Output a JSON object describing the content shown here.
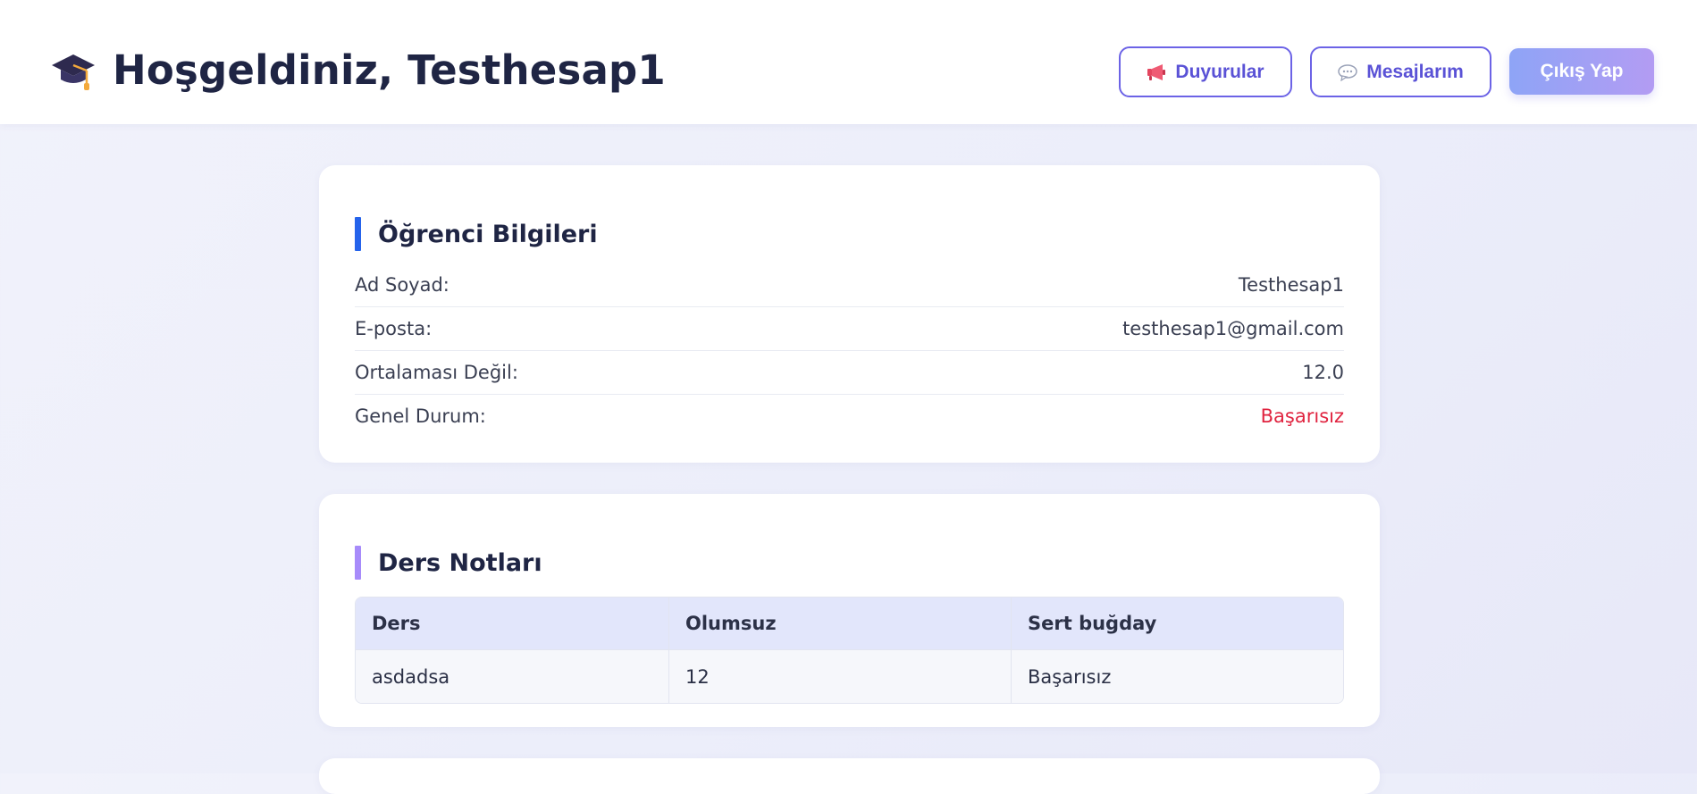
{
  "header": {
    "welcome": "Hoşgeldiniz, Testhesap1",
    "announcements_label": "Duyurular",
    "messages_label": "Mesajlarım",
    "logout_label": "Çıkış Yap",
    "icons": {
      "logo": "graduation-cap-icon",
      "announcements": "megaphone-icon",
      "messages": "speech-bubble-icon"
    }
  },
  "student_info": {
    "title": "Öğrenci Bilgileri",
    "accent": "#2563eb",
    "rows": [
      {
        "label": "Ad Soyad:",
        "value": "Testhesap1"
      },
      {
        "label": "E-posta:",
        "value": "testhesap1@gmail.com"
      },
      {
        "label": "Ortalaması Değil:",
        "value": "12.0"
      },
      {
        "label": "Genel Durum:",
        "value": "Başarısız"
      }
    ]
  },
  "grades": {
    "title": "Ders Notları",
    "accent": "#a78bfa",
    "columns": [
      "Ders",
      "Olumsuz",
      "Sert buğday"
    ],
    "rows": [
      [
        "asdadsa",
        "12",
        "Başarısız"
      ]
    ]
  },
  "colors": {
    "fail": "#e0233f",
    "primary": "#5a52d6",
    "logout_gradient": [
      "#8ea4f6",
      "#b39cf3"
    ]
  }
}
